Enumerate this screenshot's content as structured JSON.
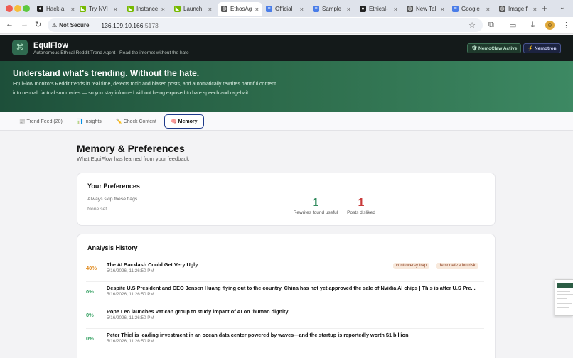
{
  "browser": {
    "tabs": [
      {
        "title": "Hack-a",
        "fav": "github",
        "color": "#222222"
      },
      {
        "title": "Try NVI",
        "fav": "nvidia",
        "color": "#76b900"
      },
      {
        "title": "Instance",
        "fav": "nvidia",
        "color": "#76b900"
      },
      {
        "title": "Launch",
        "fav": "nvidia",
        "color": "#76b900"
      },
      {
        "title": "EthosAg",
        "fav": "globe",
        "color": "#555555"
      },
      {
        "title": "Official",
        "fav": "docs",
        "color": "#4a7de8"
      },
      {
        "title": "Sample",
        "fav": "docs",
        "color": "#4a7de8"
      },
      {
        "title": "Ethical-",
        "fav": "github",
        "color": "#222222"
      },
      {
        "title": "New Tal",
        "fav": "globe",
        "color": "#555555"
      },
      {
        "title": "Google",
        "fav": "google-docs",
        "color": "#4a7de8"
      },
      {
        "title": "Image f",
        "fav": "globe",
        "color": "#555555"
      }
    ],
    "active_tab_index": 4,
    "security_label": "Not Secure",
    "url_host": "136.109.10.166",
    "url_port": ":5173"
  },
  "header": {
    "brand": "EquiFlow",
    "tagline": "Autonomous Ethical Reddit Trend Agent · Read the internet without the hate",
    "badge_nemoclaw": "🛡 NemoClaw Active",
    "badge_nemotron": "⚡ Nemotron"
  },
  "hero": {
    "title": "Understand what's trending. Without the hate.",
    "description": "EquiFlow monitors Reddit trends in real time, detects toxic and biased posts, and automatically rewrites harmful content into neutral, factual summaries — so you stay informed without being exposed to hate speech and ragebait."
  },
  "nav_tabs": {
    "trend_feed": "📰 Trend Feed (20)",
    "insights": "📊 Insights",
    "check_content": "✏️ Check Content",
    "memory": "🧠 Memory"
  },
  "main": {
    "title": "Memory & Preferences",
    "subtitle": "What EquiFlow has learned from your feedback"
  },
  "preferences": {
    "title": "Your Preferences",
    "skip_label": "Always skip these flags",
    "skip_value": "None set",
    "rewrites_useful_count": "1",
    "rewrites_useful_label": "Rewrites found useful",
    "posts_disliked_count": "1",
    "posts_disliked_label": "Posts disliked",
    "colors": {
      "useful": "#2f8a5c",
      "disliked": "#c93b3b"
    }
  },
  "history": {
    "title": "Analysis History",
    "rows": [
      {
        "score": "40%",
        "title": "The AI Backlash Could Get Very Ugly",
        "date": "5/16/2026, 11:26:50 PM",
        "flags": [
          "controversy trap",
          "demonetization risk"
        ]
      },
      {
        "score": "0%",
        "title": "Despite U.S President and CEO Jensen Huang flying out to the country, China has not yet approved the sale of Nvidia AI chips | This is after U.S Pre...",
        "date": "5/16/2026, 11:26:50 PM",
        "flags": []
      },
      {
        "score": "0%",
        "title": "Pope Leo launches Vatican group to study impact of AI on ‘human dignity’",
        "date": "5/16/2026, 11:26:50 PM",
        "flags": []
      },
      {
        "score": "0%",
        "title": "Peter Thiel is leading investment in an ocean data center powered by waves—and the startup is reportedly worth $1 billion",
        "date": "5/16/2026, 11:26:50 PM",
        "flags": []
      }
    ],
    "score_colors": {
      "warn": "#e08a1e",
      "ok": "#2f9e5e"
    }
  }
}
